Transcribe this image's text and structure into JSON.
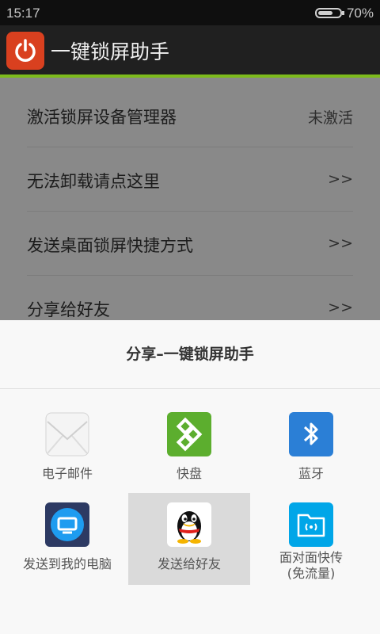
{
  "status_bar": {
    "time": "15:17",
    "battery": "70%",
    "battery_level": 0.7
  },
  "app_bar": {
    "title": "一键锁屏助手"
  },
  "settings": [
    {
      "label": "激活锁屏设备管理器",
      "value": "未激活"
    },
    {
      "label": "无法卸载请点这里",
      "value": ">>"
    },
    {
      "label": "发送桌面锁屏快捷方式",
      "value": ">>"
    },
    {
      "label": "分享给好友",
      "value": ">>"
    }
  ],
  "share_sheet": {
    "title": "分享–一键锁屏助手",
    "items": [
      {
        "label": "电子邮件",
        "icon": "mail-icon"
      },
      {
        "label": "快盘",
        "icon": "kuaipan-icon"
      },
      {
        "label": "蓝牙",
        "icon": "bluetooth-icon"
      },
      {
        "label": "发送到我的电脑",
        "icon": "computer-icon"
      },
      {
        "label": "发送给好友",
        "icon": "qq-icon",
        "selected": true
      },
      {
        "label": "面对面快传\n(免流量)",
        "icon": "file-transfer-icon"
      }
    ]
  }
}
